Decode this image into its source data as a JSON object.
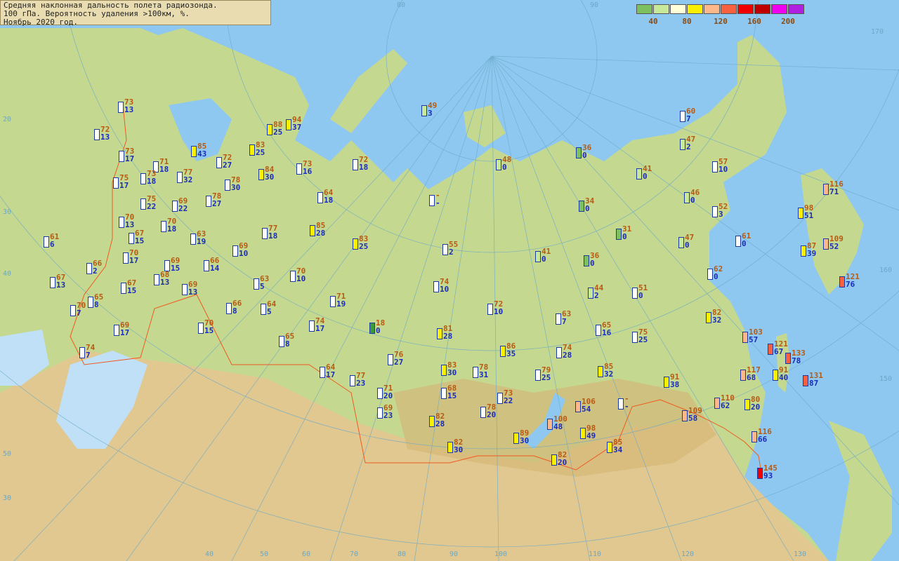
{
  "info": {
    "line1": "Средняя наклонная дальность полета радиозонда.",
    "line2": "100 гПа. Вероятность удаления >100км, %.",
    "line3": "Ноябрь 2020 год."
  },
  "legend": {
    "colors": [
      "#7cc060",
      "#c8e89a",
      "#ffffd8",
      "#f8f000",
      "#fcb88a",
      "#f86040",
      "#f00000",
      "#c00000",
      "#f000f0",
      "#b020e0"
    ],
    "labels": [
      "40",
      "80",
      "120",
      "160",
      "200"
    ]
  },
  "grid_labels": {
    "lon": [
      "80",
      "90",
      "40",
      "50",
      "60",
      "70",
      "80",
      "90",
      "100",
      "110",
      "120",
      "130",
      "150",
      "160",
      "170"
    ],
    "lat": [
      "20",
      "30",
      "40",
      "50",
      "30"
    ]
  },
  "stations": [
    {
      "v1": "73",
      "v2": "13",
      "c": "#ffffff"
    },
    {
      "v1": "72",
      "v2": "13",
      "c": "#ffffff"
    },
    {
      "v1": "73",
      "v2": "17",
      "c": "#ffffff"
    },
    {
      "v1": "71",
      "v2": "18",
      "c": "#ffffff"
    },
    {
      "v1": "75",
      "v2": "17",
      "c": "#ffffff"
    },
    {
      "v1": "73",
      "v2": "18",
      "c": "#ffffff"
    },
    {
      "v1": "77",
      "v2": "32",
      "c": "#ffffff"
    },
    {
      "v1": "85",
      "v2": "43",
      "c": "#f8f000"
    },
    {
      "v1": "72",
      "v2": "27",
      "c": "#ffffff"
    },
    {
      "v1": "83",
      "v2": "25",
      "c": "#f8f000"
    },
    {
      "v1": "88",
      "v2": "25",
      "c": "#f8f000"
    },
    {
      "v1": "94",
      "v2": "37",
      "c": "#f8f000"
    },
    {
      "v1": "75",
      "v2": "22",
      "c": "#ffffff"
    },
    {
      "v1": "69",
      "v2": "22",
      "c": "#ffffff"
    },
    {
      "v1": "78",
      "v2": "27",
      "c": "#ffffff"
    },
    {
      "v1": "78",
      "v2": "30",
      "c": "#ffffff"
    },
    {
      "v1": "84",
      "v2": "30",
      "c": "#f8f000"
    },
    {
      "v1": "73",
      "v2": "16",
      "c": "#ffffff"
    },
    {
      "v1": "72",
      "v2": "18",
      "c": "#ffffff"
    },
    {
      "v1": "49",
      "v2": "3",
      "c": "#c8e89a"
    },
    {
      "v1": "70",
      "v2": "13",
      "c": "#ffffff"
    },
    {
      "v1": "70",
      "v2": "18",
      "c": "#ffffff"
    },
    {
      "v1": "67",
      "v2": "15",
      "c": "#ffffff"
    },
    {
      "v1": "63",
      "v2": "19",
      "c": "#ffffff"
    },
    {
      "v1": "77",
      "v2": "18",
      "c": "#ffffff"
    },
    {
      "v1": "85",
      "v2": "28",
      "c": "#f8f000"
    },
    {
      "v1": "64",
      "v2": "18",
      "c": "#ffffff"
    },
    {
      "v1": "83",
      "v2": "25",
      "c": "#f8f000"
    },
    {
      "v1": "48",
      "v2": "0",
      "c": "#c8e89a"
    },
    {
      "v1": "36",
      "v2": "0",
      "c": "#7cc060"
    },
    {
      "v1": "60",
      "v2": "7",
      "c": "#ffffff"
    },
    {
      "v1": "47",
      "v2": "2",
      "c": "#c8e89a"
    },
    {
      "v1": "41",
      "v2": "0",
      "c": "#c8e89a"
    },
    {
      "v1": "57",
      "v2": "10",
      "c": "#ffffff"
    },
    {
      "v1": "46",
      "v2": "0",
      "c": "#c8e89a"
    },
    {
      "v1": "34",
      "v2": "0",
      "c": "#7cc060"
    },
    {
      "v1": "52",
      "v2": "3",
      "c": "#ffffff"
    },
    {
      "v1": "116",
      "v2": "71",
      "c": "#fcb88a"
    },
    {
      "v1": "98",
      "v2": "51",
      "c": "#f8f000"
    },
    {
      "v1": "61",
      "v2": "6",
      "c": "#ffffff"
    },
    {
      "v1": "66",
      "v2": "2",
      "c": "#ffffff"
    },
    {
      "v1": "70",
      "v2": "17",
      "c": "#ffffff"
    },
    {
      "v1": "69",
      "v2": "15",
      "c": "#ffffff"
    },
    {
      "v1": "66",
      "v2": "14",
      "c": "#ffffff"
    },
    {
      "v1": "69",
      "v2": "10",
      "c": "#ffffff"
    },
    {
      "v1": "55",
      "v2": "2",
      "c": "#ffffff"
    },
    {
      "v1": "41",
      "v2": "0",
      "c": "#c8e89a"
    },
    {
      "v1": "31",
      "v2": "0",
      "c": "#7cc060"
    },
    {
      "v1": "36",
      "v2": "0",
      "c": "#7cc060"
    },
    {
      "v1": "47",
      "v2": "0",
      "c": "#c8e89a"
    },
    {
      "v1": "61",
      "v2": "0",
      "c": "#ffffff"
    },
    {
      "v1": "87",
      "v2": "39",
      "c": "#f8f000"
    },
    {
      "v1": "109",
      "v2": "52",
      "c": "#fcb88a"
    },
    {
      "v1": "67",
      "v2": "13",
      "c": "#ffffff"
    },
    {
      "v1": "68",
      "v2": "13",
      "c": "#ffffff"
    },
    {
      "v1": "69",
      "v2": "13",
      "c": "#ffffff"
    },
    {
      "v1": "63",
      "v2": "5",
      "c": "#ffffff"
    },
    {
      "v1": "70",
      "v2": "10",
      "c": "#ffffff"
    },
    {
      "v1": "74",
      "v2": "10",
      "c": "#ffffff"
    },
    {
      "v1": "62",
      "v2": "0",
      "c": "#ffffff"
    },
    {
      "v1": "121",
      "v2": "76",
      "c": "#f86040"
    },
    {
      "v1": "65",
      "v2": "8",
      "c": "#ffffff"
    },
    {
      "v1": "67",
      "v2": "15",
      "c": "#ffffff"
    },
    {
      "v1": "70",
      "v2": "7",
      "c": "#ffffff"
    },
    {
      "v1": "66",
      "v2": "8",
      "c": "#ffffff"
    },
    {
      "v1": "64",
      "v2": "5",
      "c": "#ffffff"
    },
    {
      "v1": "71",
      "v2": "19",
      "c": "#ffffff"
    },
    {
      "v1": "72",
      "v2": "10",
      "c": "#ffffff"
    },
    {
      "v1": "63",
      "v2": "7",
      "c": "#ffffff"
    },
    {
      "v1": "44",
      "v2": "2",
      "c": "#c8e89a"
    },
    {
      "v1": "51",
      "v2": "0",
      "c": "#ffffff"
    },
    {
      "v1": "82",
      "v2": "32",
      "c": "#f8f000"
    },
    {
      "v1": "69",
      "v2": "17",
      "c": "#ffffff"
    },
    {
      "v1": "70",
      "v2": "15",
      "c": "#ffffff"
    },
    {
      "v1": "74",
      "v2": "17",
      "c": "#ffffff"
    },
    {
      "v1": "18",
      "v2": "0",
      "c": "#3a9a40"
    },
    {
      "v1": "81",
      "v2": "28",
      "c": "#f8f000"
    },
    {
      "v1": "65",
      "v2": "16",
      "c": "#ffffff"
    },
    {
      "v1": "75",
      "v2": "25",
      "c": "#ffffff"
    },
    {
      "v1": "74",
      "v2": "7",
      "c": "#ffffff"
    },
    {
      "v1": "65",
      "v2": "8",
      "c": "#ffffff"
    },
    {
      "v1": "86",
      "v2": "35",
      "c": "#f8f000"
    },
    {
      "v1": "74",
      "v2": "28",
      "c": "#ffffff"
    },
    {
      "v1": "103",
      "v2": "57",
      "c": "#fcb88a"
    },
    {
      "v1": "121",
      "v2": "67",
      "c": "#f86040"
    },
    {
      "v1": "133",
      "v2": "78",
      "c": "#f86040"
    },
    {
      "v1": "76",
      "v2": "27",
      "c": "#ffffff"
    },
    {
      "v1": "64",
      "v2": "17",
      "c": "#ffffff"
    },
    {
      "v1": "83",
      "v2": "30",
      "c": "#f8f000"
    },
    {
      "v1": "78",
      "v2": "31",
      "c": "#ffffff"
    },
    {
      "v1": "85",
      "v2": "32",
      "c": "#f8f000"
    },
    {
      "v1": "79",
      "v2": "25",
      "c": "#ffffff"
    },
    {
      "v1": "91",
      "v2": "38",
      "c": "#f8f000"
    },
    {
      "v1": "117",
      "v2": "68",
      "c": "#fcb88a"
    },
    {
      "v1": "91",
      "v2": "40",
      "c": "#f8f000"
    },
    {
      "v1": "131",
      "v2": "87",
      "c": "#f86040"
    },
    {
      "v1": "77",
      "v2": "23",
      "c": "#ffffff"
    },
    {
      "v1": "71",
      "v2": "20",
      "c": "#ffffff"
    },
    {
      "v1": "68",
      "v2": "15",
      "c": "#ffffff"
    },
    {
      "v1": "73",
      "v2": "22",
      "c": "#ffffff"
    },
    {
      "v1": "106",
      "v2": "54",
      "c": "#fcb88a"
    },
    {
      "v1": "110",
      "v2": "62",
      "c": "#fcb88a"
    },
    {
      "v1": "80",
      "v2": "20",
      "c": "#f8f000"
    },
    {
      "v1": "69",
      "v2": "23",
      "c": "#ffffff"
    },
    {
      "v1": "78",
      "v2": "20",
      "c": "#ffffff"
    },
    {
      "v1": "82",
      "v2": "28",
      "c": "#f8f000"
    },
    {
      "v1": "100",
      "v2": "48",
      "c": "#fcb88a"
    },
    {
      "v1": "109",
      "v2": "58",
      "c": "#fcb88a"
    },
    {
      "v1": "89",
      "v2": "30",
      "c": "#f8f000"
    },
    {
      "v1": "98",
      "v2": "49",
      "c": "#f8f000"
    },
    {
      "v1": "116",
      "v2": "66",
      "c": "#fcb88a"
    },
    {
      "v1": "82",
      "v2": "30",
      "c": "#f8f000"
    },
    {
      "v1": "85",
      "v2": "34",
      "c": "#f8f000"
    },
    {
      "v1": "82",
      "v2": "20",
      "c": "#f8f000"
    },
    {
      "v1": "145",
      "v2": "93",
      "c": "#f00000"
    },
    {
      "v1": "-",
      "v2": "-",
      "c": "#ffffff"
    },
    {
      "v1": "-",
      "v2": "-",
      "c": "#ffffff"
    }
  ]
}
